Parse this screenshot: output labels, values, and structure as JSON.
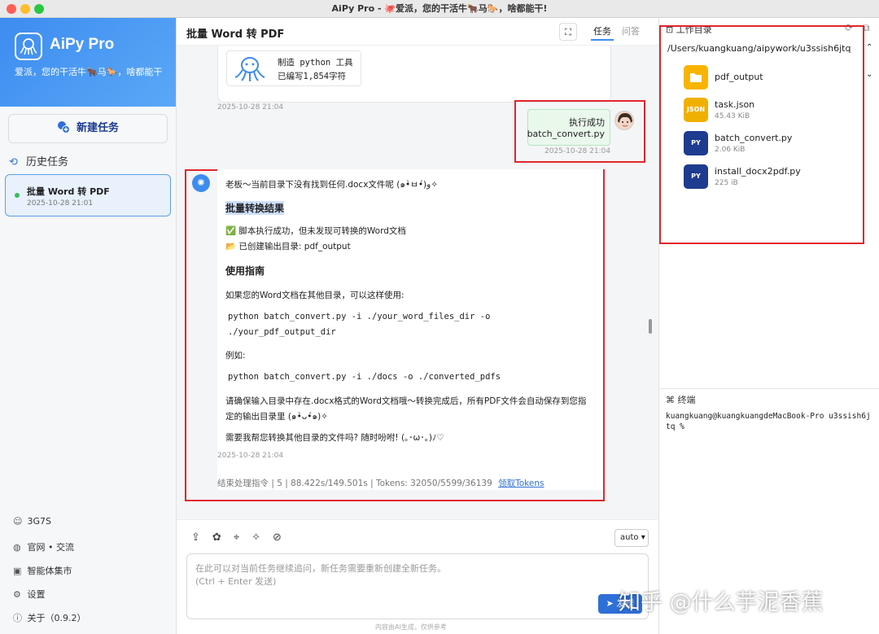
{
  "window": {
    "title": "AiPy Pro - 🐙爱派，您的干活牛🐂马🐎，啥都能干!"
  },
  "brand": {
    "title": "AiPy Pro",
    "subtitle": "爱派，您的干活牛🐂马🐎，啥都能干"
  },
  "sidebar": {
    "new_task": "新建任务",
    "history_label": "历史任务",
    "tasks": [
      {
        "title": "批量 Word 转 PDF",
        "time": "2025-10-28 21:01"
      }
    ],
    "footer": {
      "user": "3G7S",
      "website": "官网 • 交流",
      "market": "智能体集市",
      "settings": "设置",
      "about": "关于（0.9.2）"
    }
  },
  "chat": {
    "title": "批量 Word 转 PDF",
    "tab_task": "任务",
    "tab_qa": "问答",
    "tool_card": {
      "line1": "制造 python 工具",
      "line2": "已编写1,854字符"
    },
    "time1": "2025-10-28 21:04",
    "user_msg": {
      "line1": "执行成功",
      "line2": "batch_convert.py",
      "time": "2025-10-28 21:04"
    },
    "reply": {
      "intro": "老板～当前目录下没有找到任何.docx文件呢 (๑•̀ㅂ•́)و✧",
      "heading1": "批量转换结果",
      "result1": "✅ 脚本执行成功，但未发现可转换的Word文档",
      "result2": "📂 已创建输出目录: pdf_output",
      "heading2": "使用指南",
      "guide": "如果您的Word文档在其他目录，可以这样使用:",
      "code1a": "python batch_convert.py -i ./your_word_files_dir -o",
      "code1b": "./your_pdf_output_dir",
      "example_label": "例如:",
      "code2": "python batch_convert.py -i ./docs -o ./converted_pdfs",
      "note1": "请确保输入目录中存在.docx格式的Word文档哦～转换完成后，所有PDF文件会自动保存到您指",
      "note2": "定的输出目录里 (๑•̀ᴗ•́๑)✧",
      "question": "需要我帮您转换其他目录的文件吗? 随时吩咐! (｡･ω･｡)ﾉ♡",
      "time": "2025-10-28 21:04",
      "stats": "结束处理指令 | 5 | 88.422s/149.501s | Tokens: 32050/5599/36139",
      "token_link": "领取Tokens"
    },
    "input": {
      "placeholder1": "在此可以对当前任务继续追问，新任务需要重新创建全新任务。",
      "placeholder2": "(Ctrl + Enter 发送)",
      "mode": "auto",
      "send": "发送",
      "disclaimer": "内容由AI生成，仅供参考"
    }
  },
  "workspace": {
    "title": "工作目录",
    "path": "/Users/kuangkuang/aipywork/u3ssish6jtq",
    "files": [
      {
        "name": "pdf_output",
        "size": "",
        "icon": "folder-icon",
        "badge": ""
      },
      {
        "name": "task.json",
        "size": "45.43 KiB",
        "icon": "json-file-icon",
        "badge": "JSON"
      },
      {
        "name": "batch_convert.py",
        "size": "2.06 KiB",
        "icon": "python-file-icon",
        "badge": "PY"
      },
      {
        "name": "install_docx2pdf.py",
        "size": "225 iB",
        "icon": "python-file-icon",
        "badge": "PY"
      }
    ]
  },
  "terminal": {
    "title": "终端",
    "line1": "kuangkuang@kuangkuangdeMacBook-Pro u3ssish6j",
    "line2": "tq %"
  },
  "watermark": "知乎 @什么芋泥香蕉",
  "colors": {
    "accent": "#3d8cf0",
    "highlight_box": "#e0262b",
    "folder": "#f8b400",
    "json": "#f0b000",
    "python": "#1d3b8f"
  }
}
